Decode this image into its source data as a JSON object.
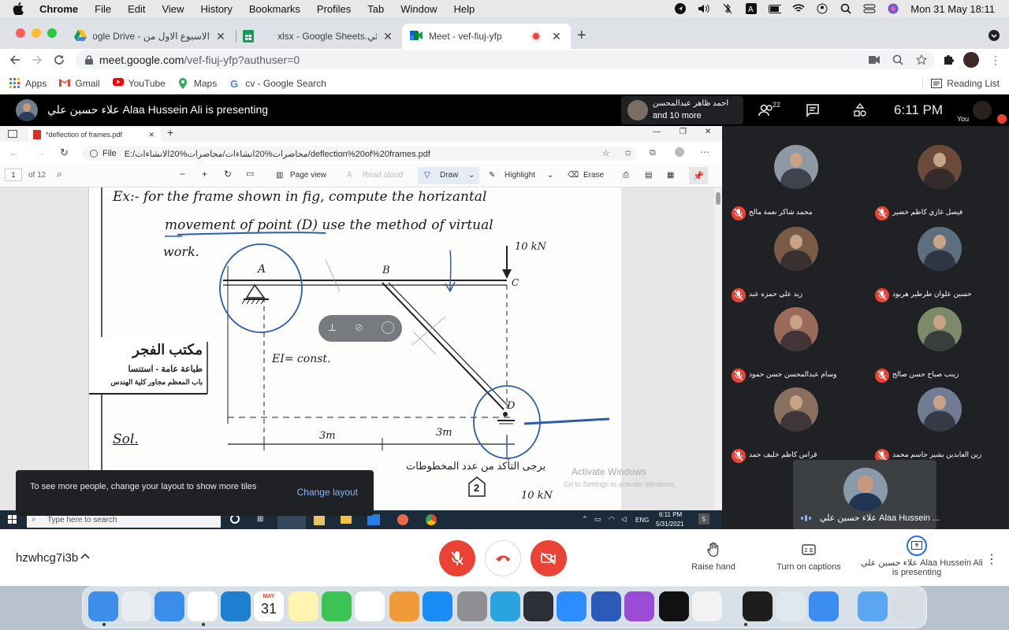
{
  "menubar": {
    "app": "Chrome",
    "items": [
      "File",
      "Edit",
      "View",
      "History",
      "Bookmarks",
      "Profiles",
      "Tab",
      "Window",
      "Help"
    ],
    "datetime": "Mon 31 May  18:11"
  },
  "tabs": [
    {
      "title": "الاسبوع الاول من - Google Drive",
      "icon": "google-drive-icon"
    },
    {
      "title": "xlsx - Google Sheets.المسائي",
      "icon": "google-sheets-icon"
    },
    {
      "title": "Meet - vef-fiuj-yfp",
      "icon": "google-meet-icon",
      "active": true
    }
  ],
  "address": {
    "host": "meet.google.com",
    "path": "/vef-fiuj-yfp?authuser=0"
  },
  "bookmarks": [
    {
      "label": "Apps",
      "icon": "apps-grid-icon"
    },
    {
      "label": "Gmail",
      "icon": "gmail-icon"
    },
    {
      "label": "YouTube",
      "icon": "youtube-icon"
    },
    {
      "label": "Maps",
      "icon": "maps-icon"
    },
    {
      "label": "cv - Google Search",
      "icon": "google-icon"
    }
  ],
  "reading_list": "Reading List",
  "meet": {
    "presenter_text": "علاء حسين علي Alaa Hussein Ali is presenting",
    "others_line1": "احمد ظاهر عبدالمحسن ...",
    "others_line2": "and 10 more",
    "participant_count": "22",
    "time": "6:11  PM",
    "you_label": "You",
    "meeting_code": "hzwhcg7i3b",
    "self_name": "علاء حسين علي Alaa Hussein ...",
    "participants": [
      {
        "name": "محمد شاكر نعمة مالح",
        "avatar": "#8e99a3"
      },
      {
        "name": "فيصل غازي كاظم خضير",
        "avatar": "#6b4a3a"
      },
      {
        "name": "زيد علي حمزه عبد",
        "avatar": "#7a5b48"
      },
      {
        "name": "حسين علوان طرطير هربود",
        "avatar": "#5d6e7f"
      },
      {
        "name": "وسام عبدالمحسن حسن حمود",
        "avatar": "#9a6a5a"
      },
      {
        "name": "زينب صباح حسن صالح",
        "avatar": "#7d8a6a"
      },
      {
        "name": "فراس كاظم خليف حمد",
        "avatar": "#8a7060"
      },
      {
        "name": "زين العابدين بشير جاسم محمد",
        "avatar": "#6f7c92"
      }
    ],
    "toast": {
      "message": "To see more people, change your layout to show more tiles",
      "action": "Change layout"
    },
    "controls": {
      "raise_hand": "Raise hand",
      "captions": "Turn on captions",
      "presenting_line1": "علاء حسين علي Alaa Hussein Ali",
      "presenting_line2": "is presenting"
    }
  },
  "shared_screen": {
    "edge_tab": "*deflection of frames.pdf",
    "edge_url_prefix": "File",
    "edge_url": "E:/محاضرات%20انشاءات/محاضرات%20الانشاءات/deflection%20of%20frames.pdf",
    "page_num": "1",
    "page_total": "of 12",
    "toolbar": {
      "page_view": "Page view",
      "read_aloud": "Read aloud",
      "draw": "Draw",
      "highlight": "Highlight",
      "erase": "Erase"
    },
    "pdf": {
      "line1": "Ex:-  for the frame shown in fig, compute the horizantal",
      "line2": "movement of point (D) use the method of virtual",
      "line3": "work.",
      "load_top": "10 kN",
      "label_a": "A",
      "label_b": "B",
      "label_c": "C",
      "label_d": "D",
      "ei": "EI= const.",
      "dim1": "3m",
      "dim2": "3m",
      "sol": "Sol.",
      "stamp1": "مكتب الفجر",
      "stamp2": "طباعة عامة - استنسا",
      "stamp3": "باب المعظم مجاور كلية الهندس",
      "note": "يرجى التأكد من عدد المخطوطات",
      "page_badge": "2",
      "load_bottom": "10 kN",
      "watermark1": "Activate Windows",
      "watermark2": "Go to Settings to activate Windows."
    },
    "taskbar": {
      "search": "Type here to search",
      "lang": "ENG",
      "time": "6:11 PM",
      "date": "5/31/2021",
      "notif": "5"
    }
  },
  "dock": {
    "calendar_month": "MAY",
    "calendar_day": "31",
    "apps": [
      "finder-icon",
      "launchpad-icon",
      "safari-icon",
      "chrome-icon",
      "vscode-icon",
      "calendar-icon",
      "notes-icon",
      "facetime-icon",
      "photos-icon",
      "books-icon",
      "appstore-icon",
      "system-preferences-icon",
      "telegram-icon",
      "proxyman-icon",
      "zoom-icon",
      "word-icon",
      "podcasts-icon",
      "appletv-icon",
      "archive-icon",
      "terminal-icon",
      "preview-icon",
      "mail-icon",
      "downloads-icon",
      "trash-icon"
    ]
  }
}
